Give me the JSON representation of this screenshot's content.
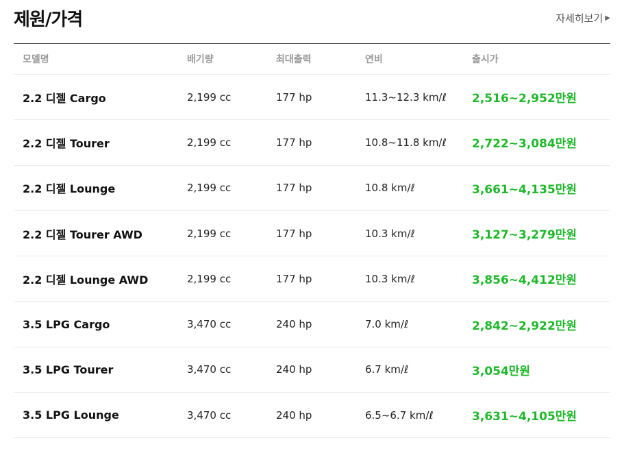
{
  "header": {
    "title": "제원/가격",
    "more_label": "자세히보기"
  },
  "table": {
    "columns": [
      "모델명",
      "배기량",
      "최대출력",
      "연비",
      "출시가"
    ],
    "rows": [
      {
        "model": "2.2 디젤 Cargo",
        "displacement": "2,199 cc",
        "power": "177 hp",
        "fuel": "11.3~12.3 km/ℓ",
        "price": "2,516~2,952만원"
      },
      {
        "model": "2.2 디젤 Tourer",
        "displacement": "2,199 cc",
        "power": "177 hp",
        "fuel": "10.8~11.8 km/ℓ",
        "price": "2,722~3,084만원"
      },
      {
        "model": "2.2 디젤 Lounge",
        "displacement": "2,199 cc",
        "power": "177 hp",
        "fuel": "10.8 km/ℓ",
        "price": "3,661~4,135만원"
      },
      {
        "model": "2.2 디젤 Tourer AWD",
        "displacement": "2,199 cc",
        "power": "177 hp",
        "fuel": "10.3 km/ℓ",
        "price": "3,127~3,279만원"
      },
      {
        "model": "2.2 디젤 Lounge AWD",
        "displacement": "2,199 cc",
        "power": "177 hp",
        "fuel": "10.3 km/ℓ",
        "price": "3,856~4,412만원"
      },
      {
        "model": "3.5 LPG Cargo",
        "displacement": "3,470 cc",
        "power": "240 hp",
        "fuel": "7.0 km/ℓ",
        "price": "2,842~2,922만원"
      },
      {
        "model": "3.5 LPG Tourer",
        "displacement": "3,470 cc",
        "power": "240 hp",
        "fuel": "6.7 km/ℓ",
        "price": "3,054만원"
      },
      {
        "model": "3.5 LPG Lounge",
        "displacement": "3,470 cc",
        "power": "240 hp",
        "fuel": "6.5~6.7 km/ℓ",
        "price": "3,631~4,105만원"
      }
    ]
  },
  "colors": {
    "price_green": "#1eb82a",
    "header_gray": "#999999",
    "divider": "#ececec"
  },
  "icons": {
    "more": "chevron-right-icon"
  }
}
